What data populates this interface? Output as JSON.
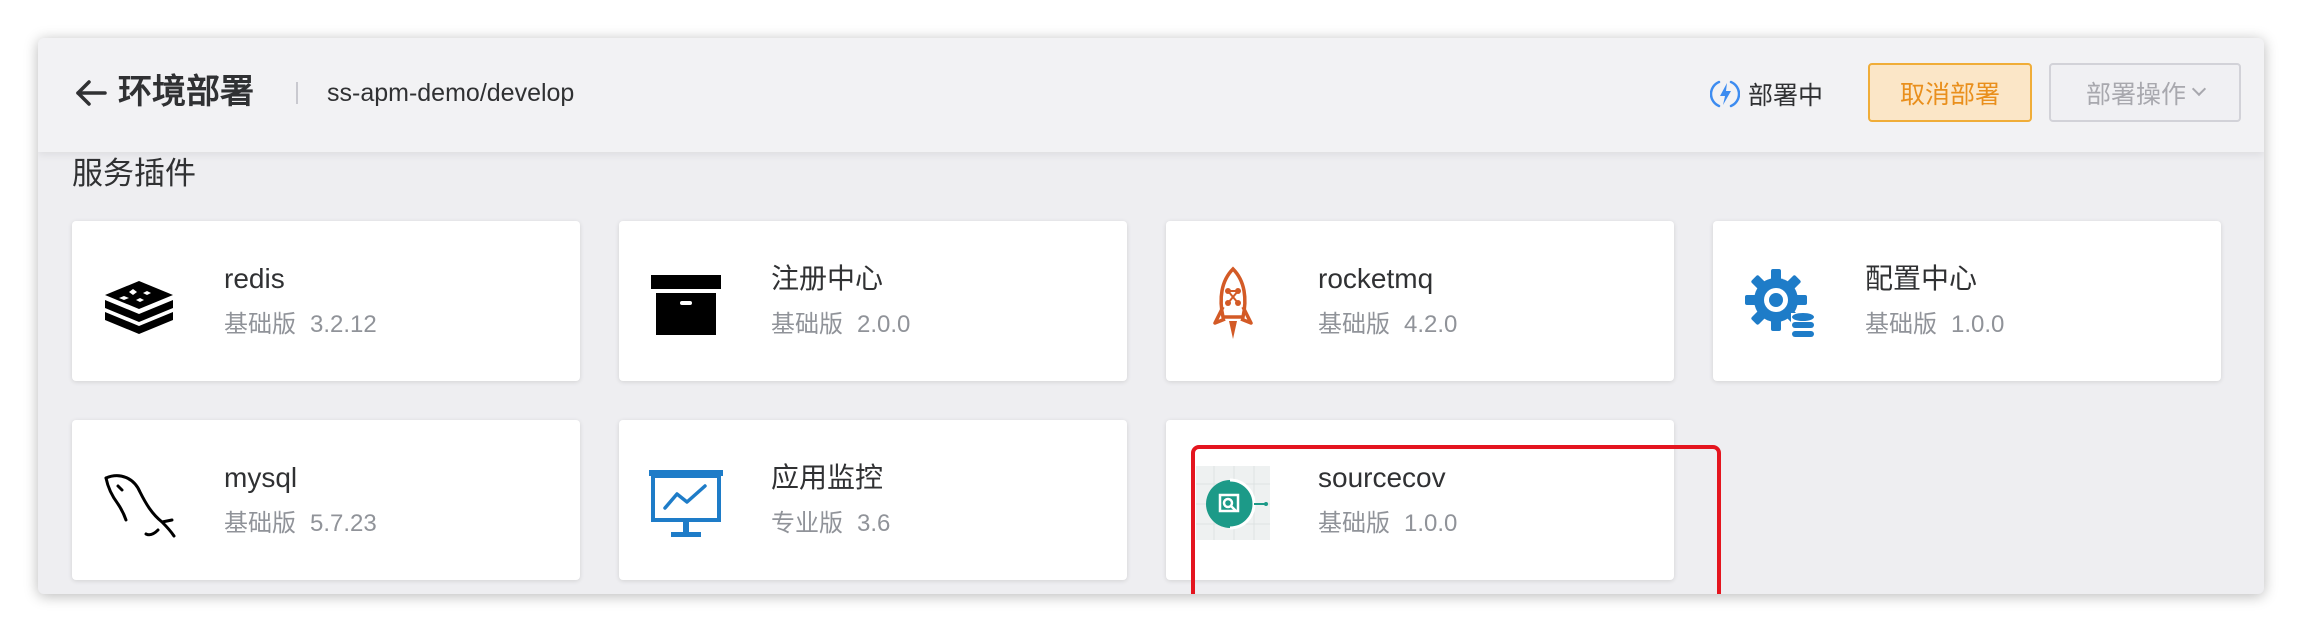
{
  "header": {
    "back_icon": "arrow-left-icon",
    "title": "环境部署",
    "breadcrumb": "ss-apm-demo/develop",
    "status_icon": "lightning-loading-icon",
    "status_text": "部署中",
    "cancel_button": "取消部署",
    "ops_button": "部署操作",
    "accent_color": "#e98f1c"
  },
  "section": {
    "title": "服务插件"
  },
  "plugins": [
    {
      "name": "redis",
      "edition": "基础版",
      "version": "3.2.12",
      "icon": "redis-icon"
    },
    {
      "name": "注册中心",
      "edition": "基础版",
      "version": "2.0.0",
      "icon": "archive-box-icon"
    },
    {
      "name": "rocketmq",
      "edition": "基础版",
      "version": "4.2.0",
      "icon": "rocket-icon"
    },
    {
      "name": "配置中心",
      "edition": "基础版",
      "version": "1.0.0",
      "icon": "gear-database-icon"
    },
    {
      "name": "mysql",
      "edition": "基础版",
      "version": "5.7.23",
      "icon": "dolphin-icon"
    },
    {
      "name": "应用监控",
      "edition": "专业版",
      "version": "3.6",
      "icon": "monitor-chart-icon"
    },
    {
      "name": "sourcecov",
      "edition": "基础版",
      "version": "1.0.0",
      "icon": "code-scan-icon"
    }
  ],
  "highlight": {
    "target": "sourcecov",
    "color": "#e4151f"
  }
}
